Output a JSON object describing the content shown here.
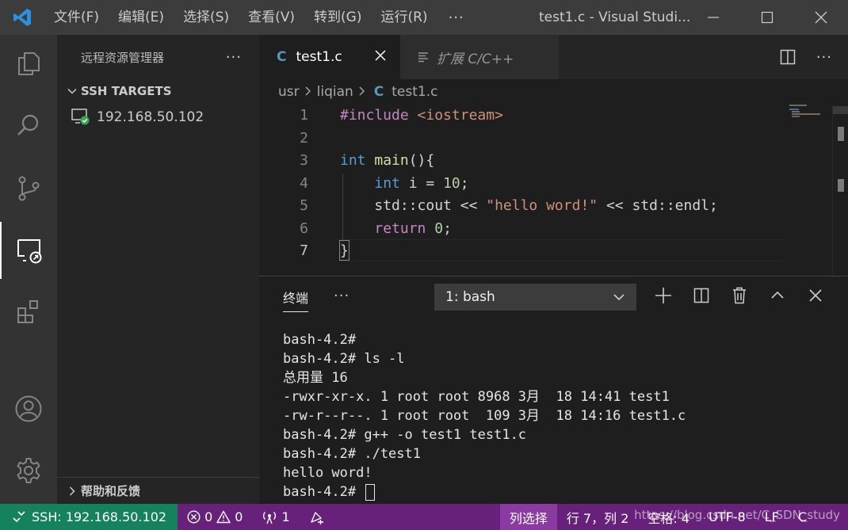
{
  "titlebar": {
    "menu": [
      "文件(F)",
      "编辑(E)",
      "选择(S)",
      "查看(V)",
      "转到(G)",
      "运行(R)"
    ],
    "more": "···",
    "window_title": "test1.c - Visual Studi..."
  },
  "sidebar": {
    "title": "远程资源管理器",
    "more": "···",
    "section": "SSH TARGETS",
    "host": "192.168.50.102",
    "footer": "帮助和反馈"
  },
  "tabs": [
    {
      "icon": "C",
      "label": "test1.c",
      "active": true
    },
    {
      "label": "扩展 C/C++",
      "active": false
    }
  ],
  "breadcrumb": {
    "parts": [
      "usr",
      "liqian"
    ],
    "file_icon": "C",
    "file": "test1.c"
  },
  "code": {
    "line_numbers": [
      "1",
      "2",
      "3",
      "4",
      "5",
      "6",
      "7"
    ],
    "lines": [
      "#include <iostream>",
      "",
      "int main(){",
      "    int i = 10;",
      "    std::cout << \"hello word!\" << std::endl;",
      "    return 0;",
      "}"
    ]
  },
  "panel": {
    "tab": "终端",
    "more": "···",
    "terminal_select": "1: bash",
    "terminal_lines": [
      "bash-4.2#",
      "bash-4.2# ls -l",
      "总用量 16",
      "-rwxr-xr-x. 1 root root 8968 3月  18 14:41 test1",
      "-rw-r--r--. 1 root root  109 3月  18 14:16 test1.c",
      "bash-4.2# g++ -o test1 test1.c",
      "bash-4.2# ./test1",
      "hello word!",
      "bash-4.2# "
    ]
  },
  "statusbar": {
    "remote": "SSH: 192.168.50.102",
    "errors": "0",
    "warnings": "0",
    "broadcast": "1",
    "selection_mode": "列选择",
    "position": "行 7，列 2",
    "spaces": "空格: 4",
    "encoding": "UTF-8",
    "eol": "LF",
    "language": "C",
    "watermark": "https://blog.csdn.net/C_SDN_study"
  },
  "colors": {
    "titlebar": "#3c3c3c",
    "activitybar": "#333333",
    "sidebar": "#252526",
    "editor": "#1e1e1e",
    "statusbar": "#68217a",
    "remote_indicator": "#16825d",
    "accent_blue": "#007acc"
  }
}
